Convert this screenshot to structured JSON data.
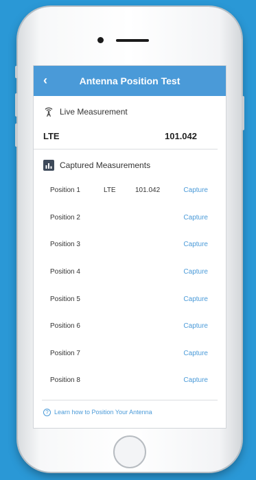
{
  "navbar": {
    "back_glyph": "‹",
    "title": "Antenna Position Test"
  },
  "live": {
    "icon": "antenna-icon",
    "heading": "Live Measurement",
    "network": "LTE",
    "value": "101.042"
  },
  "captured": {
    "icon": "bar-chart-icon",
    "heading": "Captured Measurements",
    "rows": [
      {
        "position": "Position 1",
        "network": "LTE",
        "value": "101.042",
        "action": "Capture"
      },
      {
        "position": "Position 2",
        "network": "",
        "value": "",
        "action": "Capture"
      },
      {
        "position": "Position 3",
        "network": "",
        "value": "",
        "action": "Capture"
      },
      {
        "position": "Position 4",
        "network": "",
        "value": "",
        "action": "Capture"
      },
      {
        "position": "Position 5",
        "network": "",
        "value": "",
        "action": "Capture"
      },
      {
        "position": "Position 6",
        "network": "",
        "value": "",
        "action": "Capture"
      },
      {
        "position": "Position 7",
        "network": "",
        "value": "",
        "action": "Capture"
      },
      {
        "position": "Position 8",
        "network": "",
        "value": "",
        "action": "Capture"
      }
    ]
  },
  "help": {
    "icon": "help-circle-icon",
    "label": "Learn how to Position Your Antenna"
  },
  "colors": {
    "background": "#2a98d6",
    "accent": "#4a9ad8"
  }
}
